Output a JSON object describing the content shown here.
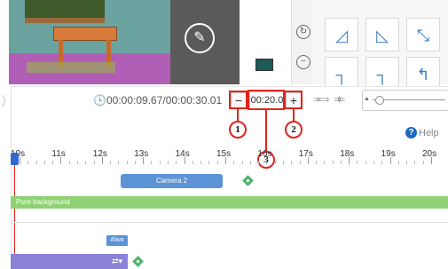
{
  "editor": {
    "time_readout": "00:00:09.67/00:00:30.01",
    "zoom_value": "00:20.0",
    "zoom_out_label": "−",
    "zoom_in_label": "+",
    "help_label": "Help"
  },
  "annotations": [
    "1",
    "2",
    "3"
  ],
  "timeline": {
    "tick_labels": [
      "10s",
      "11s",
      "12s",
      "13s",
      "14s",
      "15s",
      "16s",
      "17s",
      "18s",
      "19s",
      "20s"
    ],
    "camera_clip_label": "Camera 2",
    "background_track_label": "Pure background",
    "small_clip_label": "Alwa"
  },
  "colors": {
    "annotation": "#e0251c",
    "camera_clip": "#5b93d6",
    "background_track": "#8fd174",
    "keyframe": "#4db36a",
    "bottom_clip": "#8b82d8",
    "help_icon": "#1e68c2"
  },
  "icons": [
    "edit-icon",
    "clock-icon",
    "help-icon",
    "keyframe-icon",
    "loop-icon",
    "playhead-icon"
  ]
}
